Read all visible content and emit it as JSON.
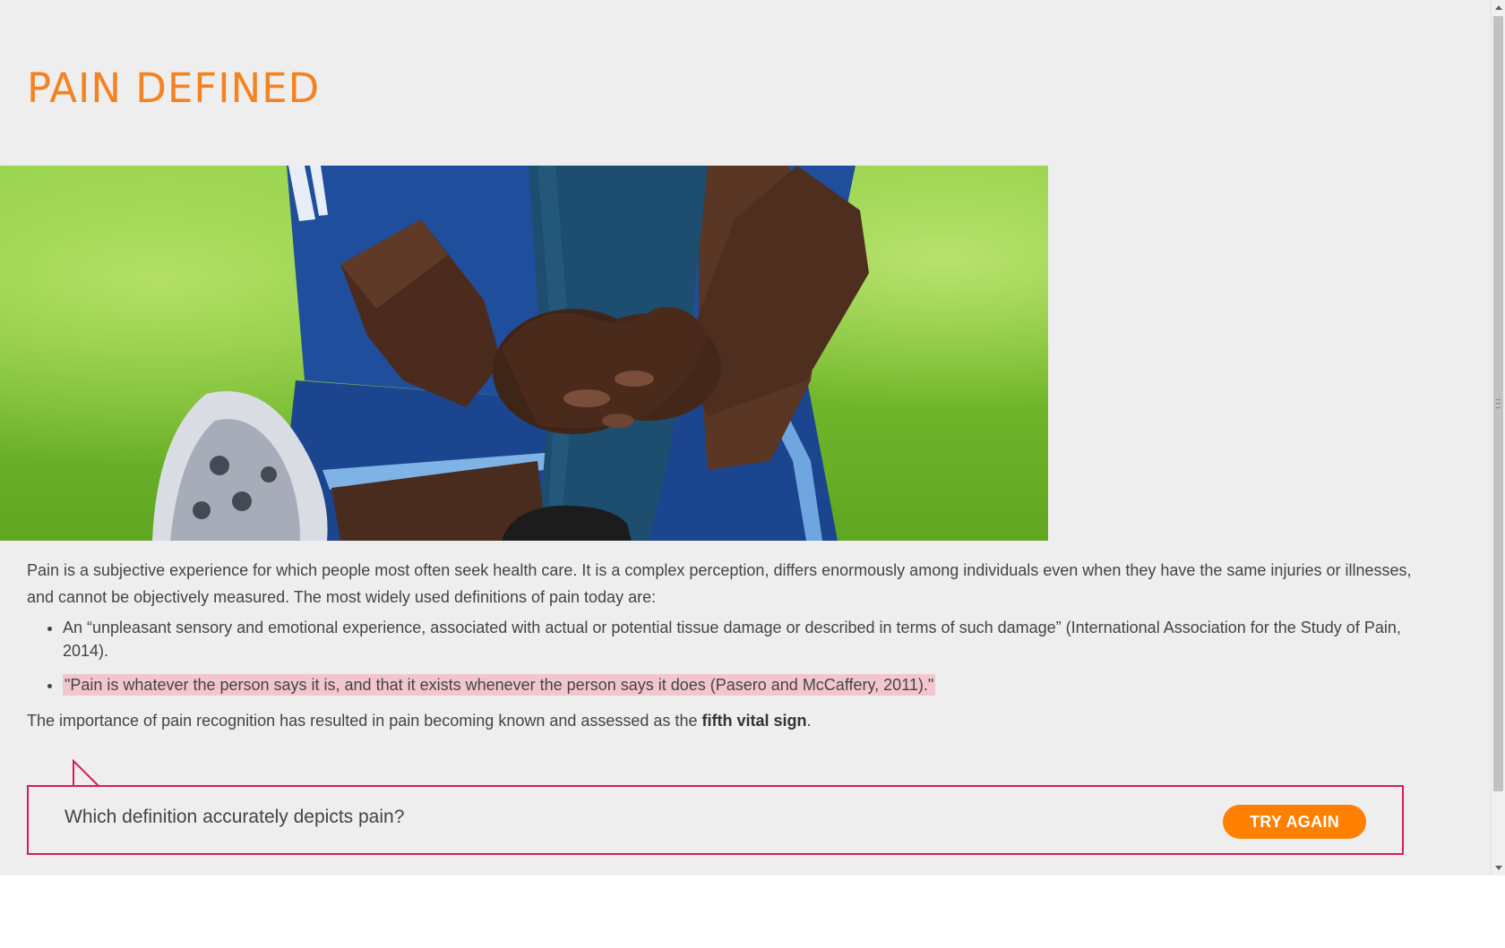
{
  "page": {
    "title": "PAIN DEFINED"
  },
  "hero_image": {
    "description_icon": "athlete-holding-knee-image"
  },
  "content": {
    "intro": "Pain is a subjective experience for which people most often seek health care. It is a complex perception, differs enormously among individuals even when they have the same injuries or illnesses, and cannot be objectively measured. The most widely used definitions of pain today are:",
    "definitions": [
      "An “unpleasant sensory and emotional experience, associated with actual or potential tissue damage or described in terms of such damage” (International Association for the Study of Pain, 2014).",
      "\"Pain is whatever the person says it is, and that it exists whenever the person says it does (Pasero and McCaffery, 2011).\""
    ],
    "closing_prefix": "The importance of pain recognition has resulted in pain becoming known and assessed as the ",
    "closing_bold": "fifth vital sign",
    "closing_suffix": "."
  },
  "question": {
    "text": "Which definition accurately depicts pain?",
    "button_label": "TRY AGAIN"
  },
  "colors": {
    "accent_orange": "#f58220",
    "button_orange": "#ff7f00",
    "border_pink": "#d81b60",
    "highlight_pink": "#f2c6cf",
    "background": "#eeeeee"
  }
}
